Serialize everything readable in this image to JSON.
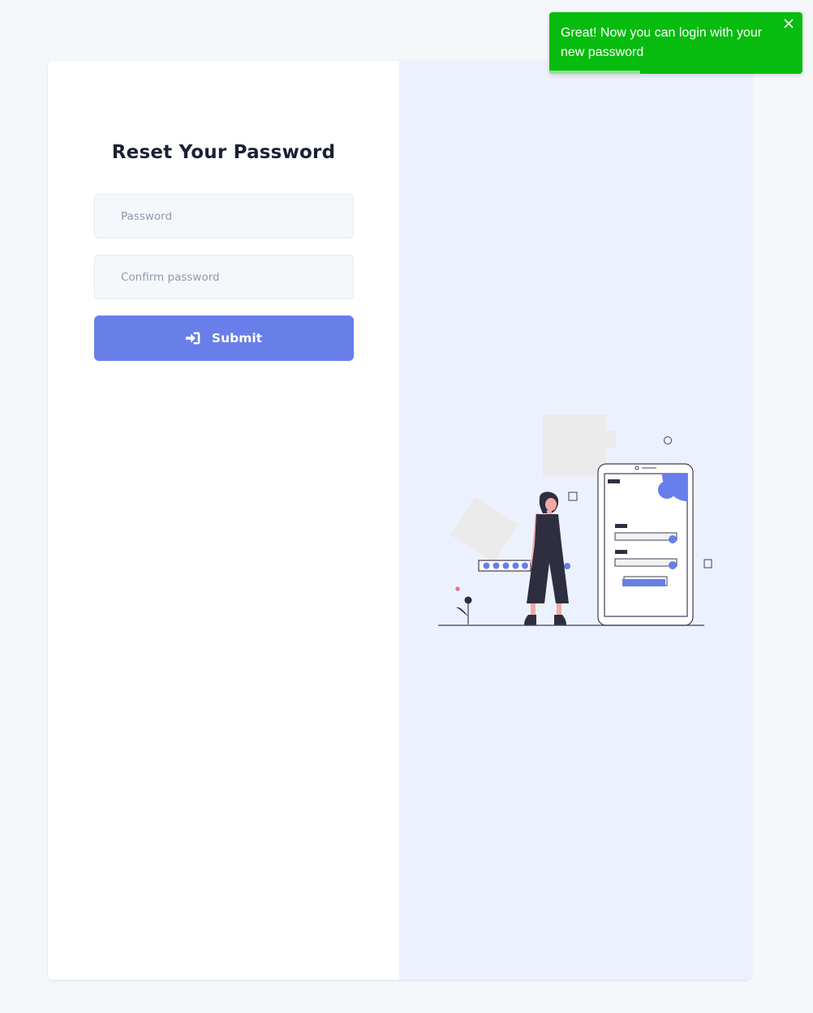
{
  "form": {
    "title": "Reset Your Password",
    "password_placeholder": "Password",
    "password_value": "",
    "confirm_placeholder": "Confirm password",
    "confirm_value": "",
    "submit_label": "Submit",
    "submit_icon": "sign-in-icon"
  },
  "illustration": {
    "name": "reset-password-illustration"
  },
  "toast": {
    "message": "Great! Now you can login with your new password",
    "close_icon": "close-icon",
    "progress": 0.36
  },
  "colors": {
    "accent": "#687ee9",
    "toast_background": "#08bc0f",
    "illustration_panel": "#ecf2fd",
    "page_background": "#f5f8fb"
  }
}
